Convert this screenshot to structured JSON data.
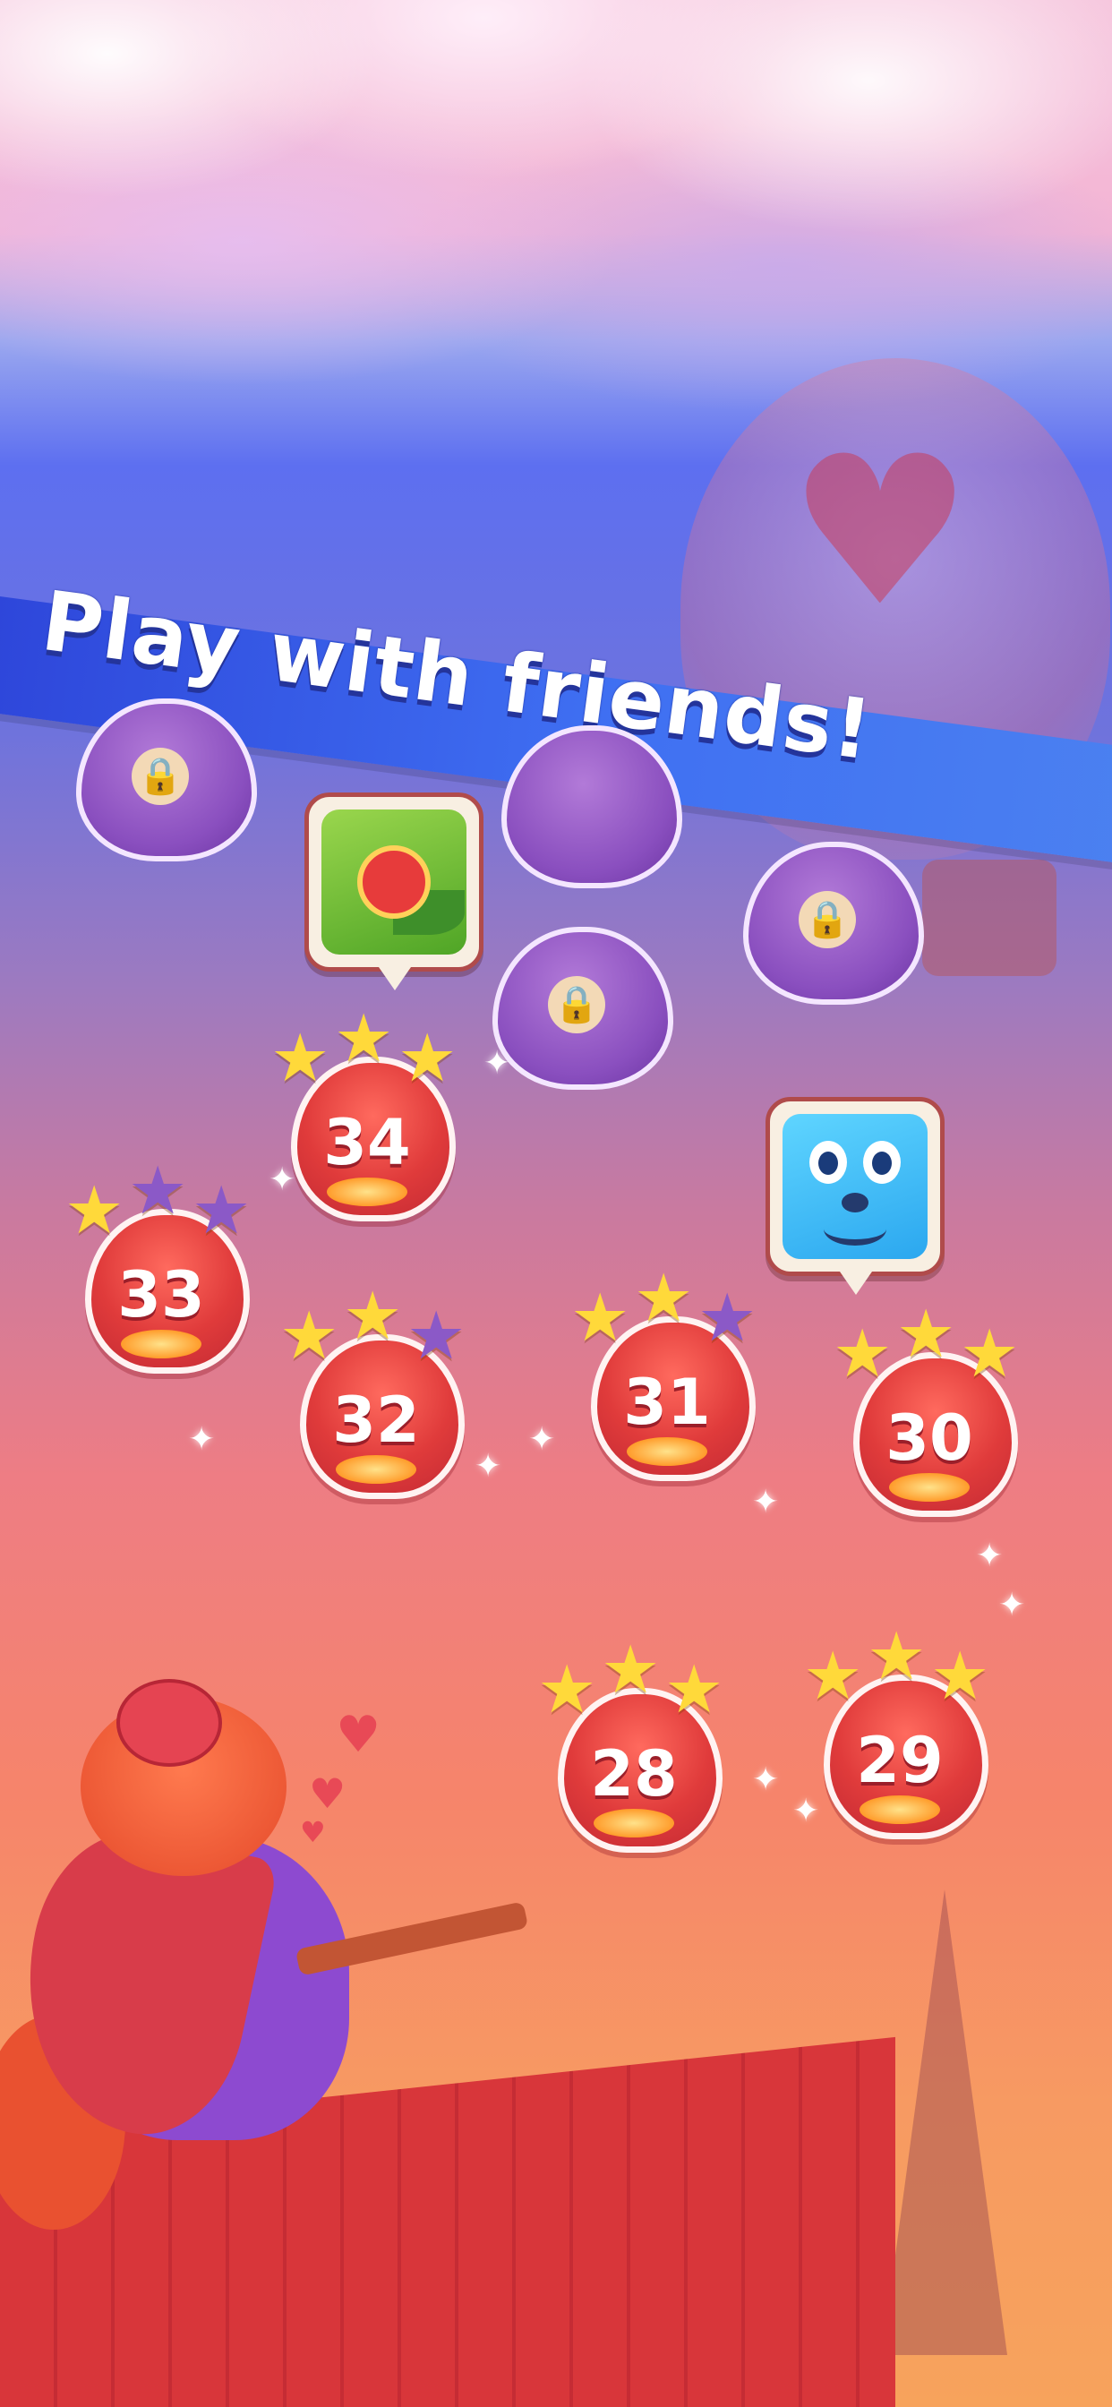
{
  "promo": {
    "headline": "Play with friends!"
  },
  "levels": [
    {
      "number": "34",
      "stars": [
        "gold",
        "gold",
        "gold"
      ]
    },
    {
      "number": "33",
      "stars": [
        "gold",
        "purple",
        "purple"
      ]
    },
    {
      "number": "32",
      "stars": [
        "gold",
        "gold",
        "purple"
      ]
    },
    {
      "number": "31",
      "stars": [
        "gold",
        "gold",
        "purple"
      ]
    },
    {
      "number": "30",
      "stars": [
        "gold",
        "gold",
        "gold"
      ]
    },
    {
      "number": "29",
      "stars": [
        "gold",
        "gold",
        "gold"
      ]
    },
    {
      "number": "28",
      "stars": [
        "gold",
        "gold",
        "gold"
      ]
    }
  ],
  "locked_levels": [
    "locked",
    "locked",
    "locked",
    "locked"
  ],
  "friend_avatars": [
    "snail-friend-icon",
    "blue-creature-friend-icon"
  ],
  "colors": {
    "banner": "#3f6ff2",
    "lantern": "#e03b3b",
    "star_gold": "#ffd93a",
    "star_purple": "#8b59c7",
    "locked": "#8a4fbf"
  }
}
